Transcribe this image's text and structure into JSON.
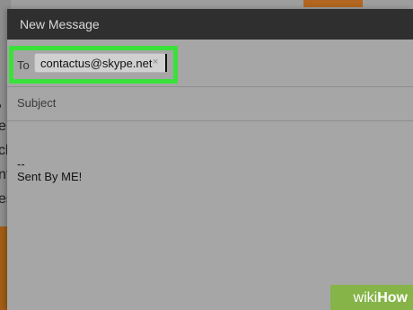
{
  "background": {
    "left_chars": [
      ",",
      "e",
      "ck",
      "nt",
      "es"
    ]
  },
  "compose": {
    "title": "New Message",
    "to_label": "To",
    "recipient": "contactus@skype.net",
    "remove_glyph": "×",
    "subject_placeholder": "Subject",
    "body_separator": "--",
    "body_signature": "Sent By ME!"
  },
  "watermark": {
    "prefix": "wiki",
    "suffix": "How"
  },
  "colors": {
    "highlight": "#3be13b",
    "title_bar": "#2f2f2f",
    "watermark": "#86b449"
  }
}
